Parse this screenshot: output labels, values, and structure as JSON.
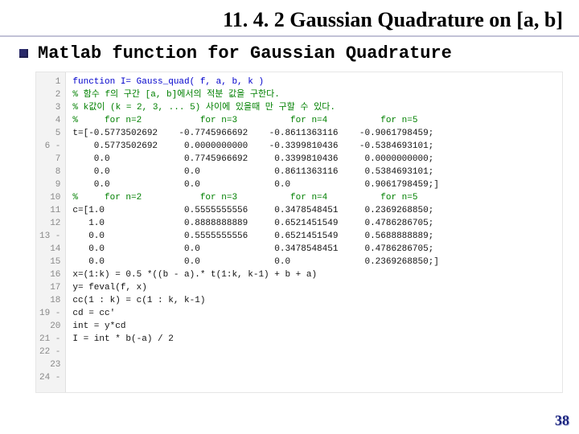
{
  "title": "11. 4. 2 Gaussian Quadrature on [a, b]",
  "subtitle": "Matlab function for Gaussian Quadrature",
  "page_number": "38",
  "code": {
    "gutter": [
      "1",
      "2",
      "3",
      "4",
      "5",
      "6 -",
      "7",
      "8",
      "9",
      "10",
      "11",
      "12",
      "13 -",
      "14",
      "15",
      "16",
      "17",
      "18",
      "19 -",
      "20",
      "21 -",
      "22 -",
      "23",
      "24 -"
    ],
    "lines": [
      {
        "cls": "kw",
        "text": "function I= Gauss_quad( f, a, b, k )"
      },
      {
        "cls": "cm",
        "text": "% 함수 f의 구간 [a, b]에서의 적분 값을 구한다."
      },
      {
        "cls": "cm",
        "text": "% k값이 (k = 2, 3, ... 5) 사이에 있을때 만 구할 수 있다."
      },
      {
        "cls": "",
        "text": ""
      },
      {
        "cls": "cm",
        "text": "%     for n=2           for n=3          for n=4          for n=5"
      },
      {
        "cls": "",
        "text": "t=[-0.5773502692    -0.7745966692    -0.8611363116    -0.9061798459;"
      },
      {
        "cls": "",
        "text": "    0.5773502692     0.0000000000    -0.3399810436    -0.5384693101;"
      },
      {
        "cls": "",
        "text": "    0.0              0.7745966692     0.3399810436     0.0000000000;"
      },
      {
        "cls": "",
        "text": "    0.0              0.0              0.8611363116     0.5384693101;"
      },
      {
        "cls": "",
        "text": "    0.0              0.0              0.0              0.9061798459;]"
      },
      {
        "cls": "",
        "text": ""
      },
      {
        "cls": "cm",
        "text": "%     for n=2           for n=3          for n=4          for n=5"
      },
      {
        "cls": "",
        "text": "c=[1.0               0.5555555556     0.3478548451     0.2369268850;"
      },
      {
        "cls": "",
        "text": "   1.0               0.8888888889     0.6521451549     0.4786286705;"
      },
      {
        "cls": "",
        "text": "   0.0               0.5555555556     0.6521451549     0.5688888889;"
      },
      {
        "cls": "",
        "text": "   0.0               0.0              0.3478548451     0.4786286705;"
      },
      {
        "cls": "",
        "text": "   0.0               0.0              0.0              0.2369268850;]"
      },
      {
        "cls": "",
        "text": ""
      },
      {
        "cls": "",
        "text": "x=(1:k) = 0.5 *((b - a).* t(1:k, k-1) + b + a)"
      },
      {
        "cls": "",
        "text": "y= feval(f, x)"
      },
      {
        "cls": "",
        "text": "cc(1 : k) = c(1 : k, k-1)"
      },
      {
        "cls": "",
        "text": "cd = cc'"
      },
      {
        "cls": "",
        "text": "int = y*cd"
      },
      {
        "cls": "",
        "text": "I = int * b(-a) / 2"
      }
    ]
  }
}
